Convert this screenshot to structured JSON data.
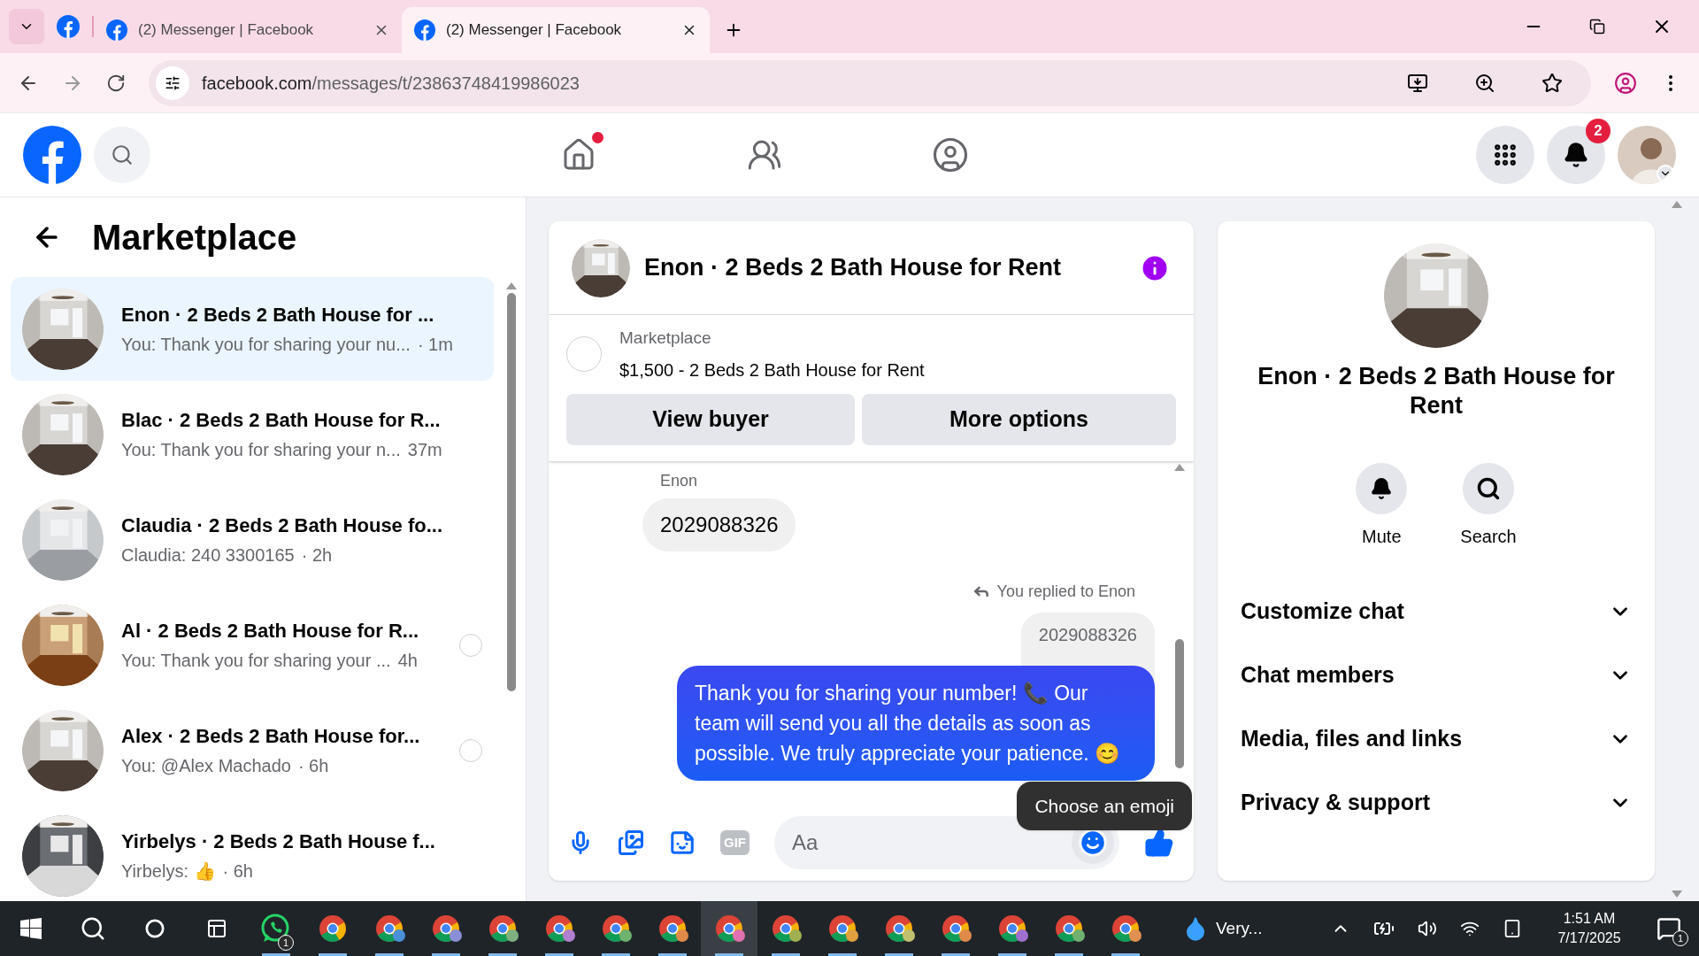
{
  "browser": {
    "tabs": [
      {
        "title": "(2) Messenger | Facebook",
        "selected": false
      },
      {
        "title": "(2) Messenger | Facebook",
        "selected": true
      }
    ],
    "url_host": "facebook.com",
    "url_path": "/messages/t/23863748419986023"
  },
  "header": {
    "nav": [
      {
        "kind": "home",
        "selected": false,
        "dot": true
      },
      {
        "kind": "friends",
        "selected": false,
        "dot": false
      },
      {
        "kind": "groups",
        "selected": false,
        "dot": false
      }
    ],
    "notification_badge": "2"
  },
  "sidebar": {
    "title": "Marketplace",
    "conversations": [
      {
        "title": "Enon · 2 Beds 2 Bath House for ...",
        "preview": "You: Thank you for sharing your nu...",
        "time": "· 1m",
        "selected": true,
        "receipt": false
      },
      {
        "title": "Blac · 2 Beds 2 Bath House for R...",
        "preview": "You: Thank you for sharing your n...",
        "time": "37m",
        "selected": false,
        "receipt": false
      },
      {
        "title": "Claudia · 2 Beds 2 Bath House fo...",
        "preview": "Claudia: 240 3300165",
        "time": "· 2h",
        "selected": false,
        "receipt": false
      },
      {
        "title": "Al · 2 Beds 2 Bath House for R...",
        "preview": "You: Thank you for sharing your ...",
        "time": "4h",
        "selected": false,
        "receipt": true
      },
      {
        "title": "Alex · 2 Beds 2 Bath House for...",
        "preview": "You: @Alex Machado",
        "time": "· 6h",
        "selected": false,
        "receipt": true
      },
      {
        "title": "Yirbelys · 2 Beds 2 Bath House f...",
        "preview": "Yirbelys: 👍",
        "time": "· 6h",
        "selected": false,
        "receipt": false
      }
    ]
  },
  "chat": {
    "title": "Enon · 2 Beds 2 Bath House for Rent",
    "listing": {
      "label": "Marketplace",
      "text": "$1,500 - 2 Beds 2 Bath House for Rent",
      "buttons": [
        "View buyer",
        "More options"
      ]
    },
    "messages": [
      {
        "kind": "incoming",
        "sender": "Enon",
        "text": "2029088326"
      },
      {
        "kind": "reply_note",
        "text": "You replied to Enon"
      },
      {
        "kind": "quoted",
        "text": "2029088326"
      },
      {
        "kind": "outgoing",
        "text": "Thank you for sharing your number! 📞 Our team will send you all the details as soon as possible. We truly appreciate your patience. 😊"
      }
    ],
    "composer": {
      "placeholder": "Aa",
      "gif": "GIF"
    },
    "tooltip": "Choose an emoji"
  },
  "details": {
    "title": "Enon · 2 Beds 2 Bath House for Rent",
    "actions": [
      {
        "kind": "bell",
        "label": "Mute"
      },
      {
        "kind": "search",
        "label": "Search"
      }
    ],
    "sections": [
      {
        "label": "Customize chat",
        "expanded": false
      },
      {
        "label": "Chat members",
        "expanded": false
      },
      {
        "label": "Media, files and links",
        "expanded": false
      },
      {
        "label": "Privacy & support",
        "expanded": false
      }
    ]
  },
  "taskbar": {
    "apps": [
      {
        "kind": "whatsapp",
        "badge": "1",
        "selected": false
      },
      {
        "kind": "chrome",
        "selected": false
      },
      {
        "kind": "chrome-profile",
        "color": "#4a90d9",
        "selected": false
      },
      {
        "kind": "chrome-profile",
        "color": "#8a8fd8",
        "selected": false
      },
      {
        "kind": "chrome-profile",
        "color": "#7fb07f",
        "selected": false
      },
      {
        "kind": "chrome-profile",
        "color": "#b07fd0",
        "selected": false
      },
      {
        "kind": "chrome-profile",
        "color": "#6fb36f",
        "selected": false
      },
      {
        "kind": "chrome-profile",
        "color": "#e08a4a",
        "selected": false
      },
      {
        "kind": "chrome-profile",
        "color": "#e070b0",
        "selected": true
      },
      {
        "kind": "chrome-profile",
        "color": "#a0b050",
        "selected": false
      },
      {
        "kind": "chrome-profile",
        "color": "#e0a040",
        "selected": false
      },
      {
        "kind": "chrome-profile",
        "color": "#c0c070",
        "selected": false
      },
      {
        "kind": "chrome-profile",
        "color": "#e08a4a",
        "selected": false
      },
      {
        "kind": "chrome-profile",
        "color": "#a070d0",
        "selected": false
      },
      {
        "kind": "chrome-profile",
        "color": "#70b070",
        "selected": false
      },
      {
        "kind": "chrome-profile",
        "color": "#e09050",
        "selected": false
      }
    ],
    "weather": "Very...",
    "time": "1:51 AM",
    "date": "7/17/2025",
    "notification_badge": "1"
  }
}
